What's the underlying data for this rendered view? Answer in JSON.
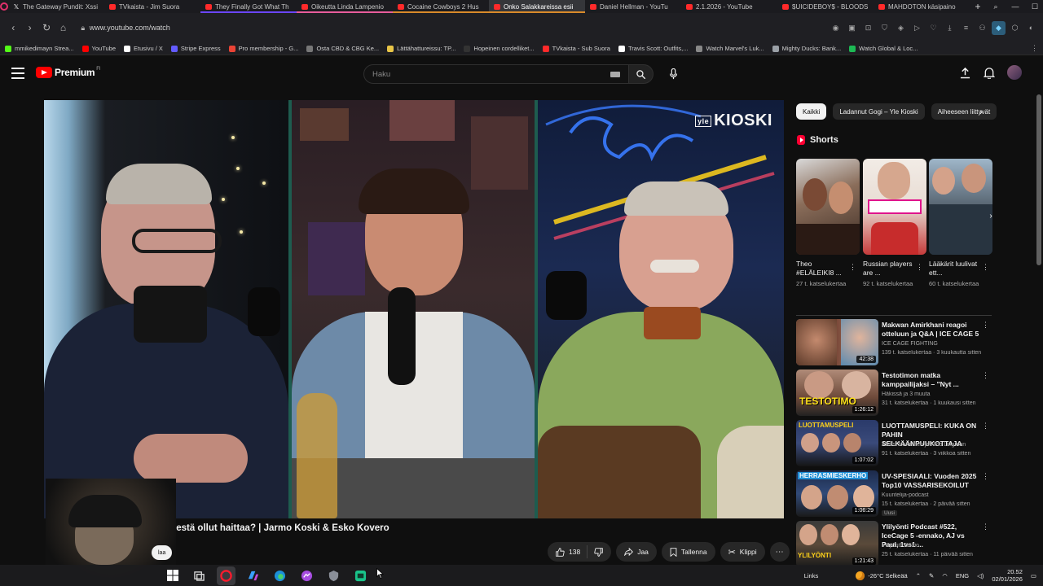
{
  "browser": {
    "tabs": [
      {
        "title": "The Gateway Pundit: Xssi",
        "fav": "x",
        "accent": ""
      },
      {
        "title": "TVkaista - Jim Suora",
        "fav": "red",
        "accent": ""
      },
      {
        "title": "They Finally Got What Th",
        "fav": "red",
        "accent": "#6b46ff"
      },
      {
        "title": "Oikeutta Linda Lampenio",
        "fav": "red",
        "accent": "#e85c9c"
      },
      {
        "title": "Cocaine Cowboys 2 Hus",
        "fav": "red",
        "accent": "#d98a2a"
      },
      {
        "title": "Onko Salakkareissa esii",
        "fav": "red",
        "accent": "#d98a2a",
        "active": true
      },
      {
        "title": "Daniel Hellman - YouTu",
        "fav": "red",
        "accent": ""
      },
      {
        "title": "2.1.2026 - YouTube",
        "fav": "red",
        "accent": ""
      },
      {
        "title": "$UICIDEBOY$ - BLOODS",
        "fav": "red",
        "accent": ""
      },
      {
        "title": "MAHDOTON käsipaino",
        "fav": "red",
        "accent": ""
      }
    ],
    "new_tab": "+",
    "url": "www.youtube.com/watch",
    "bookmarks": [
      {
        "label": "mmikedimayn Strea...",
        "color": "#53fc18"
      },
      {
        "label": "YouTube",
        "color": "#ff0000"
      },
      {
        "label": "Etusivu / X",
        "color": "#ffffff"
      },
      {
        "label": "Stripe Express",
        "color": "#635bff"
      },
      {
        "label": "Pro membership - G...",
        "color": "#ea4335"
      },
      {
        "label": "Osta CBD & CBG Ke...",
        "color": "#777777"
      },
      {
        "label": "Lättähattureissu: TP...",
        "color": "#e8c547"
      },
      {
        "label": "Hopeinen cordelliket...",
        "color": "#333333"
      },
      {
        "label": "TVkaista - Sub Suora",
        "color": "#ff2a2a"
      },
      {
        "label": "Travis Scott: Outfits,...",
        "color": "#ffffff"
      },
      {
        "label": "Watch Marvel's Luk...",
        "color": "#888888"
      },
      {
        "label": "Mighty Ducks: Bank...",
        "color": "#9aa0a6"
      },
      {
        "label": "Watch Global & Loc...",
        "color": "#1db954"
      }
    ]
  },
  "yt": {
    "logo_word": "Premium",
    "logo_sup": "FI",
    "search_placeholder": "Haku"
  },
  "video": {
    "overlay_logo": "KIOSKI",
    "overlay_logo_prefix": "yle",
    "title": "ymisestä ollut haittaa? | Jarmo Koski & Esko Kovero",
    "subscribe_label": "laa",
    "likes": "138",
    "share_label": "Jaa",
    "save_label": "Tallenna",
    "clip_label": "Klippi"
  },
  "sidebar": {
    "chips": [
      {
        "label": "Kaikki",
        "active": true
      },
      {
        "label": "Ladannut Gogi – Yle Kioski",
        "active": false
      },
      {
        "label": "Aiheeseen liittyvät",
        "active": false
      }
    ],
    "shorts_heading": "Shorts",
    "shorts": [
      {
        "title": "Theo #ELÄLEIKI8 ...",
        "views": "27 t. katselukertaa"
      },
      {
        "title": "Russian players are ...",
        "views": "92 t. katselukertaa"
      },
      {
        "title": "Lääkärit luulivat ett...",
        "views": "60 t. katselukertaa"
      }
    ],
    "recommended": [
      {
        "title": "Makwan Amirkhani reagoi otteluun ja Q&A | ICE CAGE 5",
        "channel": "ICE CAGE FIGHTING",
        "meta": "139 t. katselukertaa · 3 kuukautta sitten",
        "duration": "42:38",
        "new": ""
      },
      {
        "title": "Testotimon matka kamppailijaksi – \"Nyt ...",
        "channel": "Häkissä ja 3 muuta",
        "meta": "31 t. katselukertaa · 1 kuukausi sitten",
        "duration": "1:26:12",
        "new": ""
      },
      {
        "title": "LUOTTAMUSPELI: KUKA ON PAHIN SELKÄÄNPUUKOTTAJA",
        "channel": "Aleksi Nurminen ja Nico Lingman",
        "meta": "91 t. katselukertaa · 3 viikkoa sitten",
        "duration": "1:07:02",
        "new": ""
      },
      {
        "title": "UV-SPESIAALI: Vuoden 2025 Top10 VASSARISEKOILUT",
        "channel": "Kuuntelija-podcast",
        "meta": "15 t. katselukertaa · 2 päivää sitten",
        "duration": "1:06:29",
        "new": "Uusi"
      },
      {
        "title": "Ylilyönti Podcast #522, IceCage 5 -ennako, AJ vs Paul, 1vs1 ...",
        "channel": "Ylilyönti Studio",
        "meta": "25 t. katselukertaa · 11 päivää sitten",
        "duration": "1:21:43",
        "new": ""
      }
    ],
    "thumb_texts": [
      "",
      "TESTOTIMO",
      "LUOTTAMUSPELI",
      "HERRASMIESKERHO",
      "YLILYÖNTI"
    ]
  },
  "taskbar": {
    "links_label": "Links",
    "weather": "-26°C  Selkeää",
    "lang": "ENG",
    "time": "20.52",
    "date": "02/01/2026"
  }
}
